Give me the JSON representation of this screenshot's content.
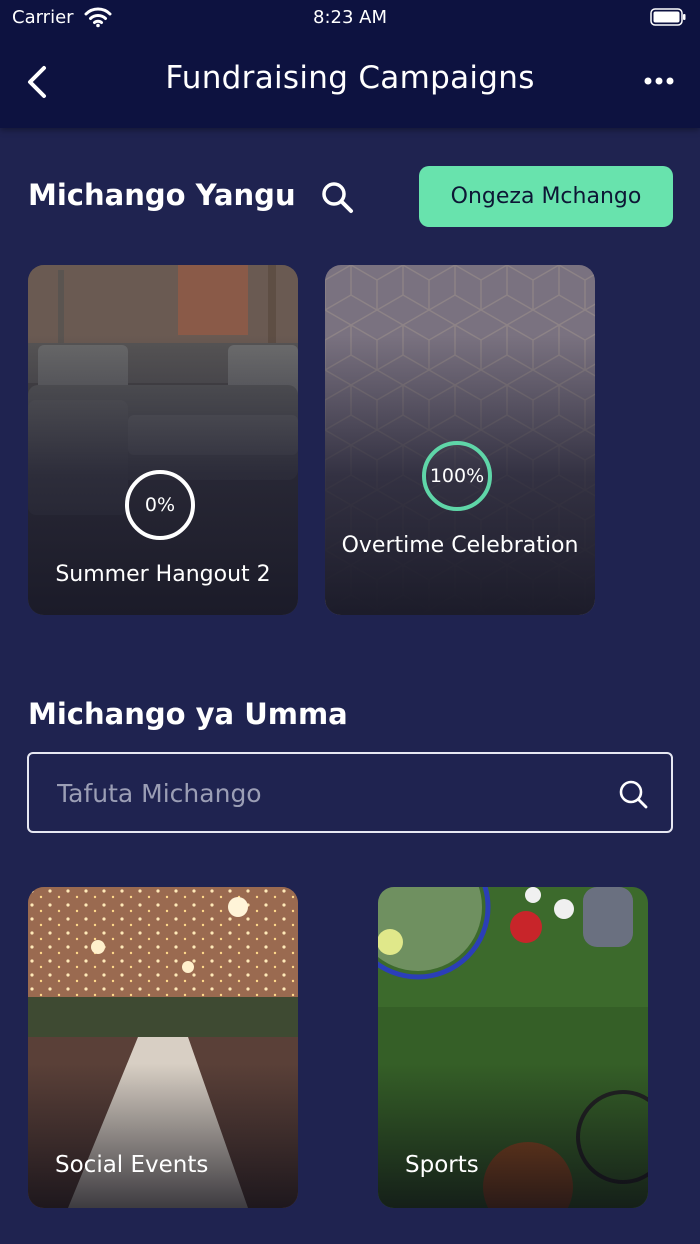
{
  "status_bar": {
    "carrier": "Carrier",
    "time": "8:23 AM"
  },
  "header": {
    "title": "Fundraising Campaigns",
    "back_icon": "chevron-left-icon",
    "more_icon": "more-horizontal-icon"
  },
  "my_campaigns": {
    "title": "Michango Yangu",
    "add_button": "Ongeza Mchango",
    "cards": [
      {
        "name": "Summer Hangout 2",
        "progress": "0%"
      },
      {
        "name": "Overtime Celebration",
        "progress": "100%"
      }
    ]
  },
  "public_campaigns": {
    "title": "Michango ya Umma",
    "search_placeholder": "Tafuta Michango",
    "categories": [
      {
        "name": "Social Events"
      },
      {
        "name": "Sports"
      }
    ]
  },
  "colors": {
    "background": "#1f2350",
    "header": "#0d1240",
    "accent": "#68e3ad"
  }
}
